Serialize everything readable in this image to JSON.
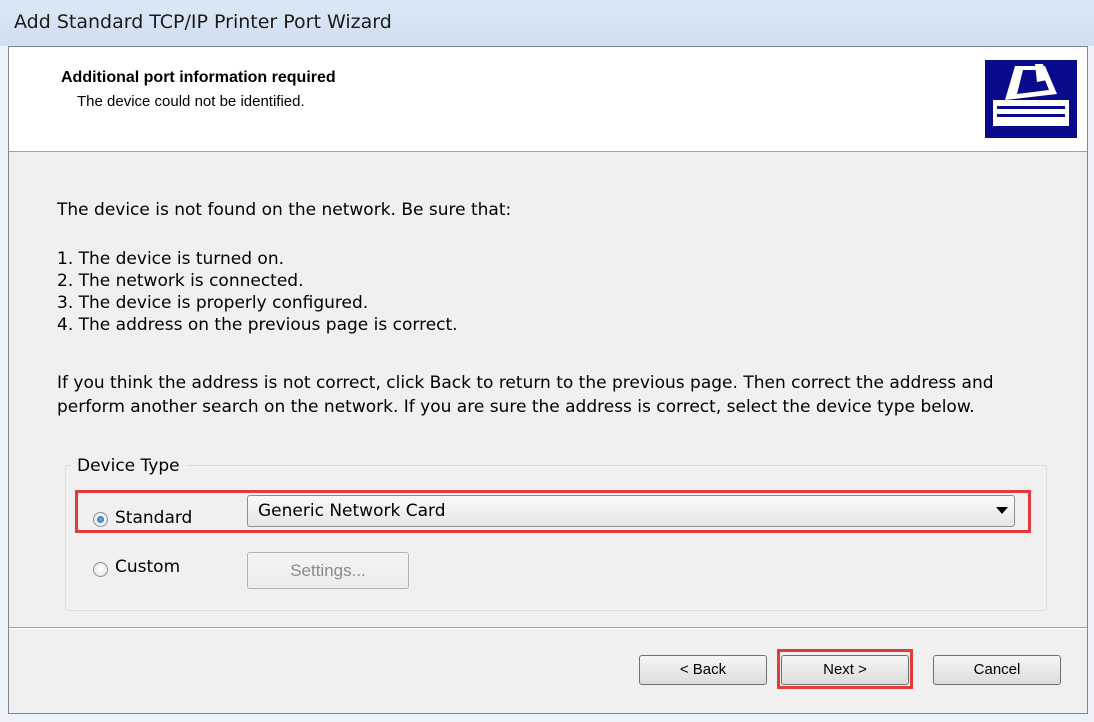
{
  "window": {
    "title": "Add Standard TCP/IP Printer Port Wizard"
  },
  "header": {
    "title": "Additional port information required",
    "subtitle": "The device could not be identified.",
    "icon": "printer-wizard-icon"
  },
  "body": {
    "intro": "The device is not found on the network.  Be sure that:",
    "checklist": [
      "1.  The device is turned on.",
      "2.  The network is connected.",
      "3.  The device is properly configured.",
      "4.  The address on the previous page is correct."
    ],
    "instructions": "If you think the address is not correct, click Back to return to the previous page.  Then correct the address and perform another search on the network.  If you are sure the address is correct, select the device type below."
  },
  "device_type": {
    "legend": "Device Type",
    "standard_label": "Standard",
    "standard_selected": true,
    "standard_value": "Generic Network Card",
    "custom_label": "Custom",
    "settings_label": "Settings..."
  },
  "buttons": {
    "back": "< Back",
    "next": "Next >",
    "cancel": "Cancel"
  },
  "colors": {
    "highlight": "#e23b3b",
    "header_bg": "#ffffff",
    "dialog_bg": "#f0f0f0"
  }
}
